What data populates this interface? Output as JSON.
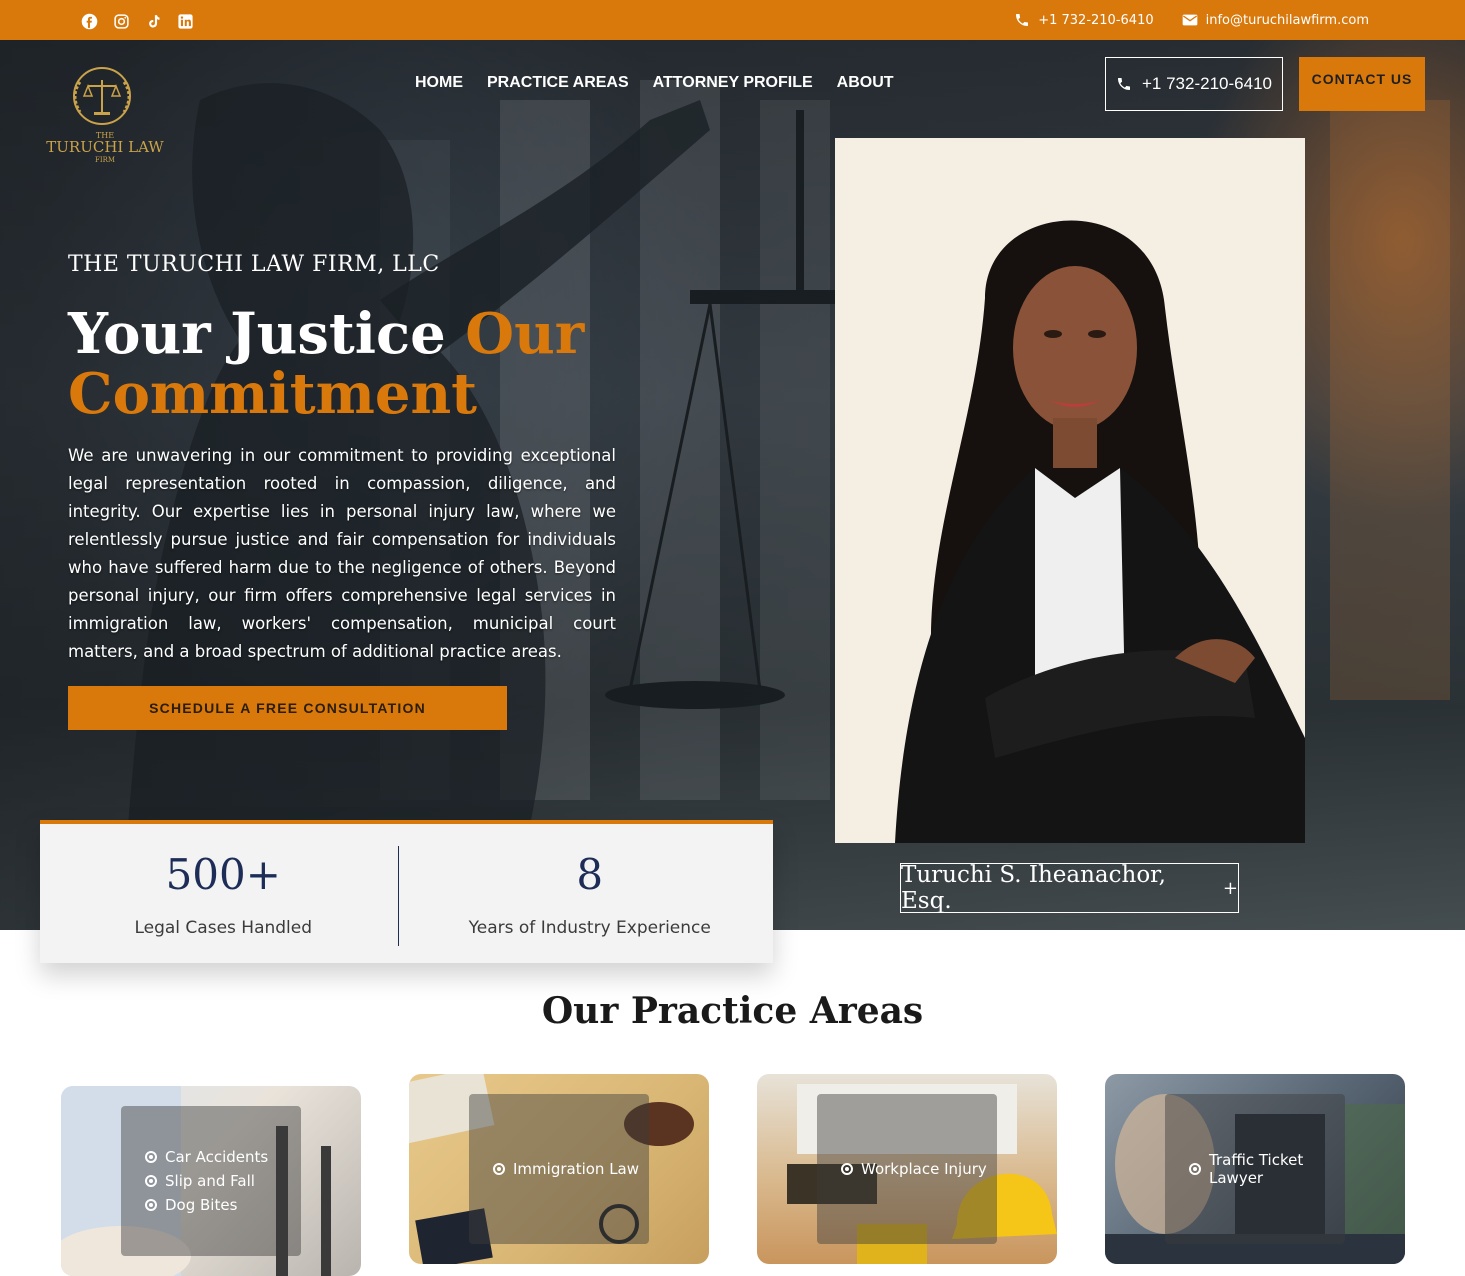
{
  "topbar": {
    "social_icons": [
      "facebook-icon",
      "instagram-icon",
      "tiktok-icon",
      "linkedin-icon"
    ],
    "phone": "+1 732-210-6410",
    "email": "info@turuchilawfirm.com"
  },
  "brand": {
    "logo_line1": "THE",
    "logo_line2": "TURUCHI LAW",
    "logo_line3": "FIRM",
    "accent_color": "#d9790c",
    "navy_color": "#1e2d57"
  },
  "nav": {
    "items": [
      "HOME",
      "PRACTICE AREAS",
      "ATTORNEY PROFILE",
      "ABOUT"
    ],
    "phone_button": "+1 732-210-6410",
    "contact_button": "CONTACT US"
  },
  "hero": {
    "firm_name": "THE TURUCHI LAW FIRM, LLC",
    "headline_white": "Your Justice ",
    "headline_accent": "Our Commitment",
    "intro": "We are unwavering in our commitment to providing exceptional legal representation rooted in compassion, diligence, and integrity. Our expertise lies in personal injury law, where we relentlessly pursue justice and fair compensation for individuals who have suffered harm due to the negligence of others. Beyond personal injury, our firm offers comprehensive legal services in immigration law, workers' compensation, municipal court matters, and a broad spectrum of additional practice areas.",
    "cta": "SCHEDULE A FREE CONSULTATION",
    "attorney_name": "Turuchi S. Iheanachor, Esq.",
    "attorney_expand": "+"
  },
  "stats": [
    {
      "value": "500+",
      "label": "Legal Cases Handled"
    },
    {
      "value": "8",
      "label": "Years of Industry Experience"
    }
  ],
  "practice": {
    "title": "Our Practice Areas",
    "cards": [
      {
        "items": [
          "Car Accidents",
          "Slip and Fall",
          "Dog Bites"
        ]
      },
      {
        "items": [
          "Immigration Law"
        ]
      },
      {
        "items": [
          "Workplace Injury"
        ]
      },
      {
        "items": [
          "Traffic Ticket Lawyer"
        ]
      }
    ]
  }
}
